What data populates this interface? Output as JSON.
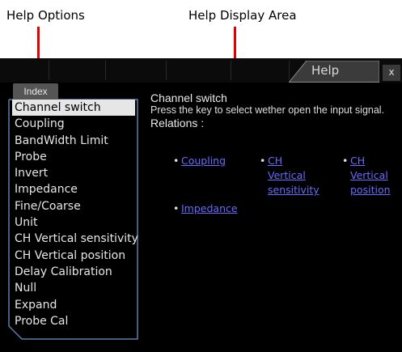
{
  "callouts": {
    "left": "Help Options",
    "right": "Help Display Area"
  },
  "window": {
    "tab_label": "Help",
    "close_label": "x"
  },
  "index": {
    "tab_label": "Index",
    "items": [
      {
        "label": "Channel switch",
        "selected": true
      },
      {
        "label": "Coupling"
      },
      {
        "label": "BandWidth Limit"
      },
      {
        "label": "Probe"
      },
      {
        "label": "Invert"
      },
      {
        "label": "Impedance"
      },
      {
        "label": "Fine/Coarse"
      },
      {
        "label": "Unit"
      },
      {
        "label": "CH Vertical sensitivity"
      },
      {
        "label": "CH Vertical position"
      },
      {
        "label": "Delay Calibration"
      },
      {
        "label": "Null"
      },
      {
        "label": "Expand"
      },
      {
        "label": "Probe Cal"
      }
    ]
  },
  "display": {
    "title": "Channel switch",
    "description": "Press the key to select wether open the input signal.",
    "relations_label": "Relations :",
    "relations": [
      {
        "lines": [
          "Coupling"
        ]
      },
      {
        "lines": [
          "CH",
          "Vertical",
          "sensitivity"
        ]
      },
      {
        "lines": [
          "CH",
          "Vertical",
          "position"
        ]
      },
      {
        "lines": [
          "Impedance"
        ]
      }
    ]
  },
  "colors": {
    "annotation_arrow": "#e00000",
    "screen_background": "#000000",
    "link": "#6a6aff",
    "selection": "#e6e6e6",
    "panel_border": "#5a7fa8"
  }
}
